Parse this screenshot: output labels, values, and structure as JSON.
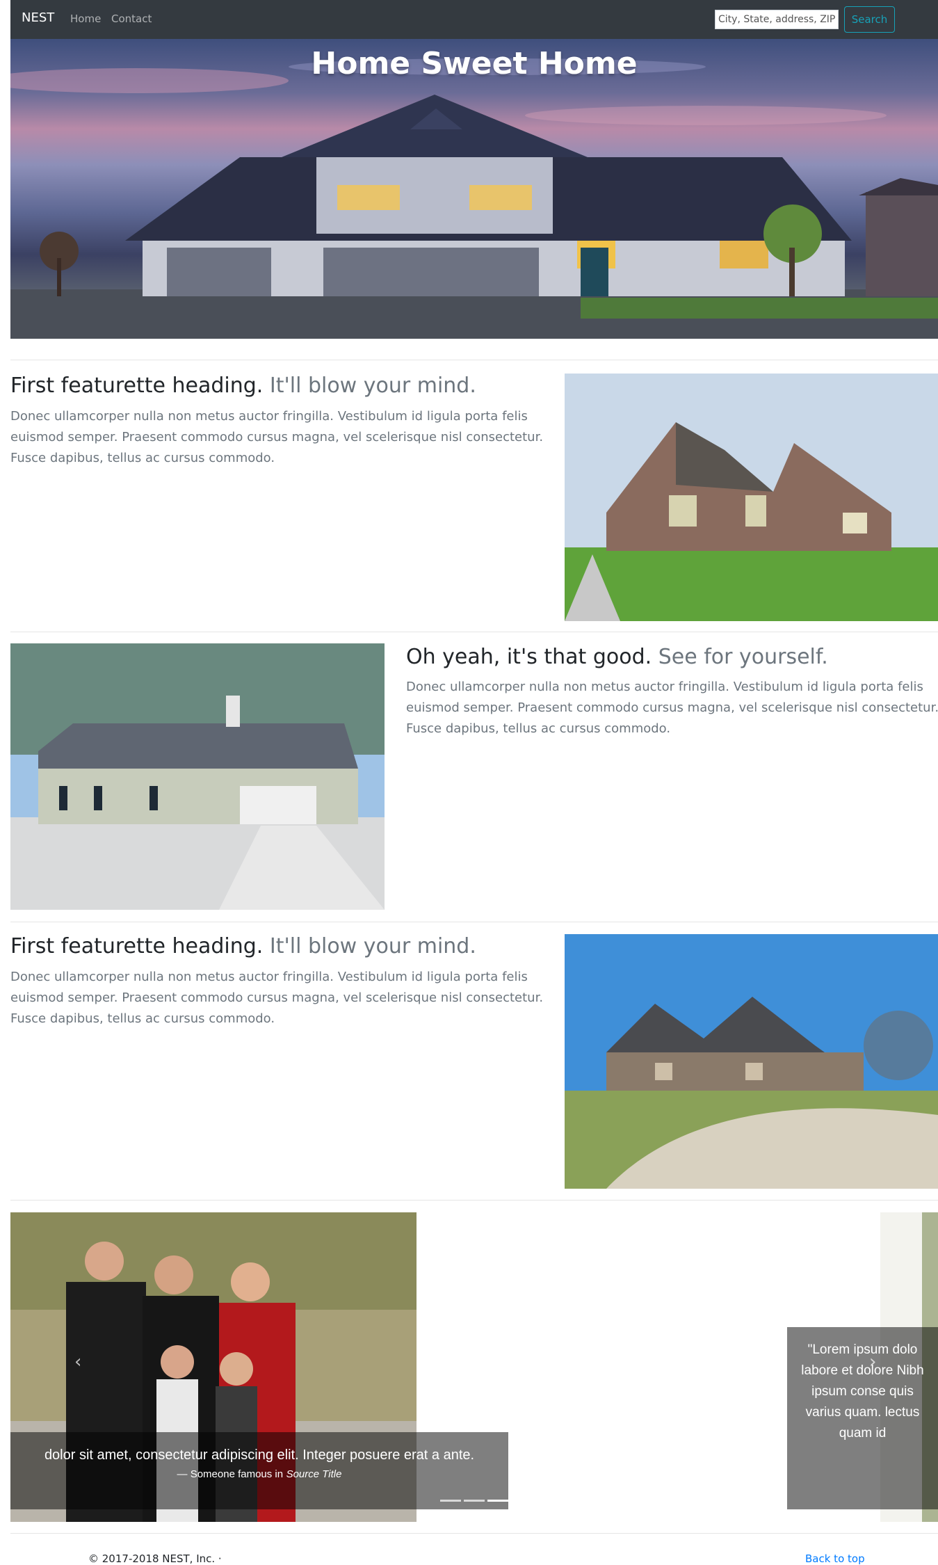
{
  "navbar": {
    "brand": "NEST",
    "links": [
      {
        "label": "Home"
      },
      {
        "label": "Contact"
      }
    ],
    "search_placeholder": "City, State, address, ZIP",
    "search_button": "Search"
  },
  "hero": {
    "title": "Home Sweet Home"
  },
  "featurettes": [
    {
      "heading": "First featurette heading.",
      "muted": "It'll blow your mind.",
      "text": "Donec ullamcorper nulla non metus auctor fringilla. Vestibulum id ligula porta felis euismod semper. Praesent commodo cursus magna, vel scelerisque nisl consectetur. Fusce dapibus, tellus ac cursus commodo."
    },
    {
      "heading": "Oh yeah, it's that good.",
      "muted": "See for yourself.",
      "text": "Donec ullamcorper nulla non metus auctor fringilla. Vestibulum id ligula porta felis euismod semper. Praesent commodo cursus magna, vel scelerisque nisl consectetur. Fusce dapibus, tellus ac cursus commodo."
    },
    {
      "heading": "First featurette heading.",
      "muted": "It'll blow your mind.",
      "text": "Donec ullamcorper nulla non metus auctor fringilla. Vestibulum id ligula porta felis euismod semper. Praesent commodo cursus magna, vel scelerisque nisl consectetur. Fusce dapibus, tellus ac cursus commodo."
    }
  ],
  "carousel": {
    "left_quote": "dolor sit amet, consectetur adipiscing elit. Integer posuere erat a ante.",
    "left_source_prefix": "— Someone famous in",
    "left_source_title": "Source Title",
    "right_quote": "\"Lorem ipsum dolo labore et dolore Nibh ipsum conse quis varius quam. lectus quam id",
    "prev_icon": "chevron-left-icon",
    "next_icon": "chevron-right-icon"
  },
  "footer": {
    "copyright": "© 2017-2018 NEST, Inc. ·",
    "back_to_top": "Back to top"
  },
  "colors": {
    "navbar_bg": "#343a40",
    "search_accent": "#17a2b8",
    "muted_text": "#6c757d",
    "link": "#007bff"
  }
}
